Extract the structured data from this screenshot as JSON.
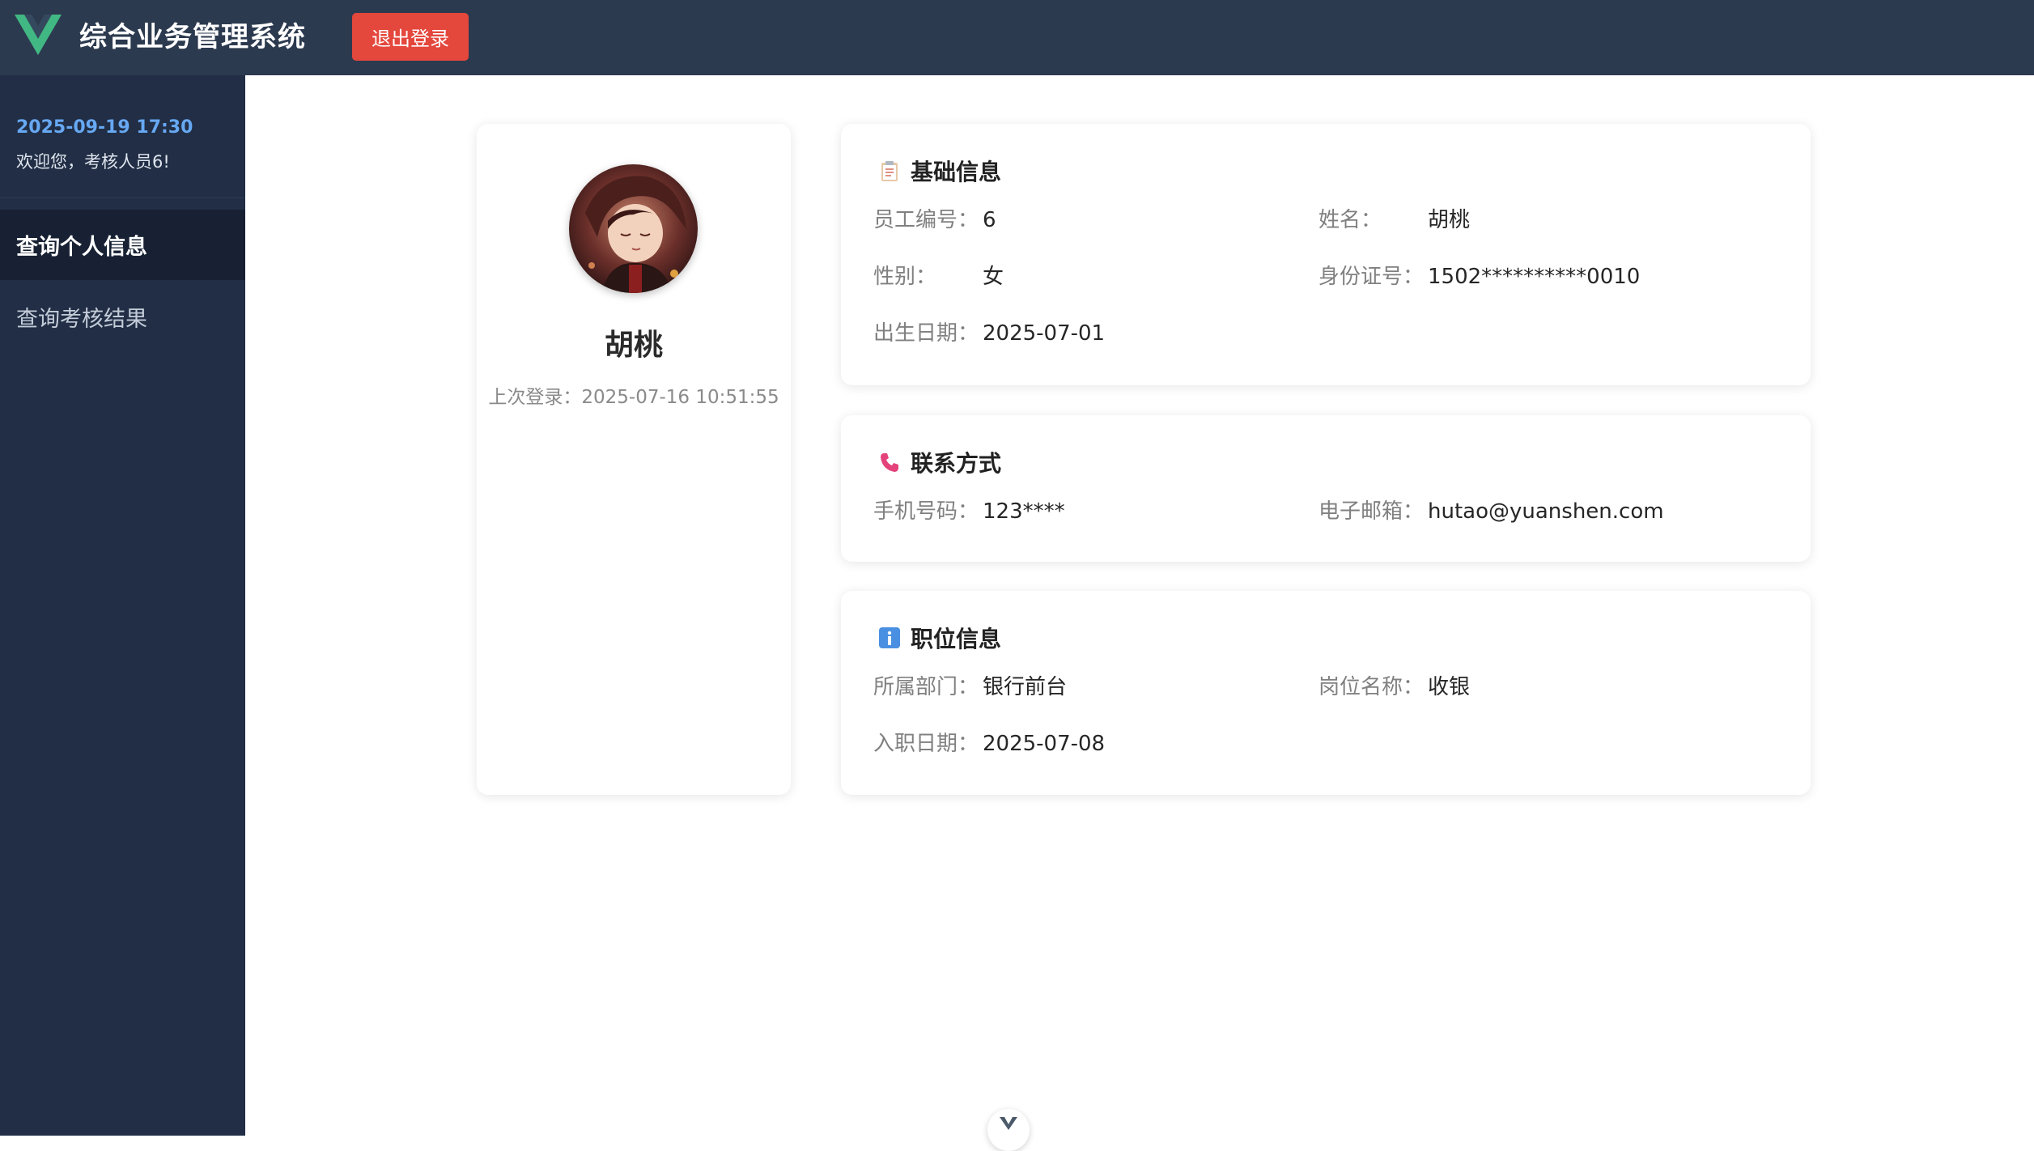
{
  "header": {
    "app_title": "综合业务管理系统",
    "logout_label": "退出登录",
    "logo_icon": "vue-logo-icon",
    "colors": {
      "background": "#2c3a4f",
      "logout": "#e4473c",
      "logo_outer": "#41b883",
      "logo_inner": "#35495e"
    }
  },
  "sidebar": {
    "datetime": "2025-09-19 17:30",
    "welcome": "欢迎您，考核人员6!",
    "items": [
      {
        "label": "查询个人信息",
        "active": true
      },
      {
        "label": "查询考核结果",
        "active": false
      }
    ],
    "colors": {
      "background": "#212e45",
      "active": "#172133",
      "date": "#67a8f3"
    }
  },
  "profile": {
    "name": "胡桃",
    "last_login": "上次登录：2025-07-16 10:51:55"
  },
  "basic_info": {
    "title": "基础信息",
    "icon": "clipboard-icon",
    "employee_no_label": "员工编号：",
    "employee_no": "6",
    "name_label": "姓名：",
    "name": "胡桃",
    "gender_label": "性别：",
    "gender": "女",
    "id_label": "身份证号：",
    "id": "1502**********0010",
    "birth_label": "出生日期：",
    "birth": "2025-07-01"
  },
  "contact": {
    "title": "联系方式",
    "icon": "phone-icon",
    "phone_label": "手机号码：",
    "phone": "123****",
    "email_label": "电子邮箱：",
    "email": "hutao@yuanshen.com"
  },
  "position": {
    "title": "职位信息",
    "icon": "info-icon",
    "dept_label": "所属部门：",
    "dept": "银行前台",
    "post_label": "岗位名称：",
    "post": "收银",
    "hire_label": "入职日期：",
    "hire": "2025-07-08"
  }
}
